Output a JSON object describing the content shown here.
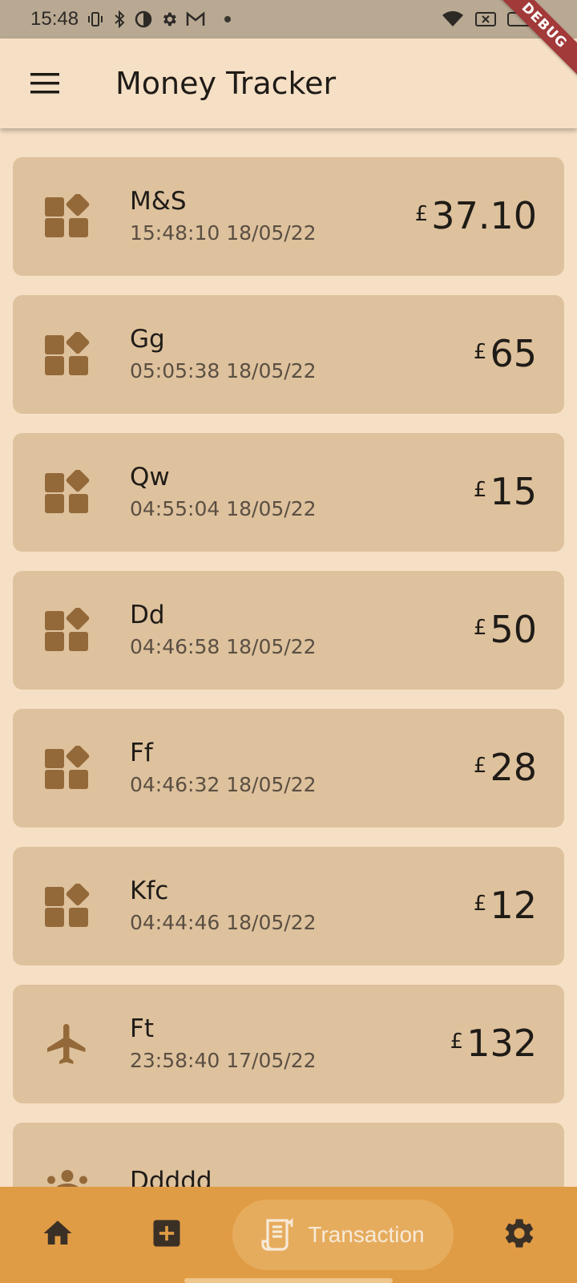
{
  "status_bar": {
    "time": "15:48",
    "left_icons": [
      "vibrate-icon",
      "bluetooth-icon",
      "data-saver-icon",
      "settings-icon",
      "gmail-icon",
      "notification-dot-icon"
    ],
    "right_icons": [
      "wifi-icon",
      "no-sim-icon",
      "battery-icon"
    ]
  },
  "debug_banner": "DEBUG",
  "app_bar": {
    "title": "Money Tracker",
    "menu_icon": "hamburger-menu-icon"
  },
  "transactions": [
    {
      "name": "M&S",
      "timestamp": "15:48:10 18/05/22",
      "currency": "£",
      "amount": "37.10",
      "icon": "category-widgets-icon"
    },
    {
      "name": "Gg",
      "timestamp": "05:05:38 18/05/22",
      "currency": "£",
      "amount": "65",
      "icon": "category-widgets-icon"
    },
    {
      "name": "Qw",
      "timestamp": "04:55:04 18/05/22",
      "currency": "£",
      "amount": "15",
      "icon": "category-widgets-icon"
    },
    {
      "name": "Dd",
      "timestamp": "04:46:58 18/05/22",
      "currency": "£",
      "amount": "50",
      "icon": "category-widgets-icon"
    },
    {
      "name": "Ff",
      "timestamp": "04:46:32 18/05/22",
      "currency": "£",
      "amount": "28",
      "icon": "category-widgets-icon"
    },
    {
      "name": "Kfc",
      "timestamp": "04:44:46 18/05/22",
      "currency": "£",
      "amount": "12",
      "icon": "category-widgets-icon"
    },
    {
      "name": "Ft",
      "timestamp": "23:58:40 17/05/22",
      "currency": "£",
      "amount": "132",
      "icon": "airplane-icon"
    },
    {
      "name": "Ddddd",
      "timestamp": "",
      "currency": "",
      "amount": "",
      "icon": "group-people-icon"
    }
  ],
  "bottom_nav": {
    "items": [
      {
        "id": "home",
        "icon": "home-icon",
        "label": ""
      },
      {
        "id": "add",
        "icon": "add-box-icon",
        "label": ""
      },
      {
        "id": "transaction",
        "icon": "receipt-icon",
        "label": "Transaction",
        "selected": true
      },
      {
        "id": "settings",
        "icon": "settings-gear-icon",
        "label": ""
      }
    ]
  },
  "colors": {
    "background": "#f6e0c5",
    "card": "#dec29d",
    "icon_brown": "#94693a",
    "nav_bar": "#e09c45",
    "nav_selected_pill": "#e6ac5d",
    "status_bar": "#b9a993"
  }
}
